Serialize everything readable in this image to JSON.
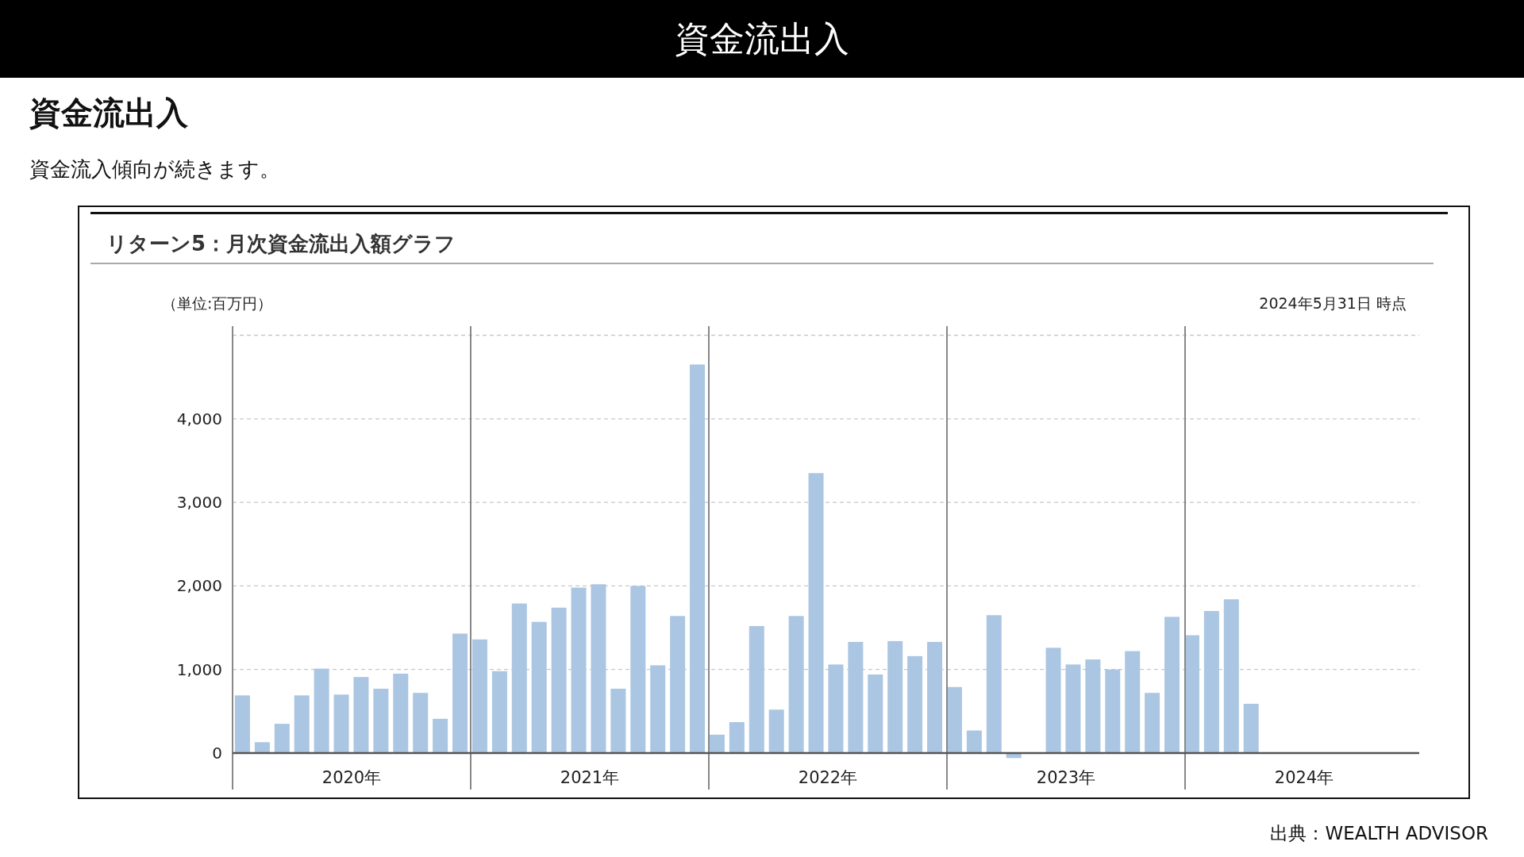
{
  "header": {
    "title": "資金流出入"
  },
  "section": {
    "heading": "資金流出入",
    "description": "資金流入傾向が続きます。"
  },
  "chart_panel": {
    "year_labels": [
      "2020年",
      "2021年",
      "2022年",
      "2023年",
      "2024年"
    ],
    "chart_data": {
      "type": "bar",
      "title": "リターン5：月次資金流出入額グラフ",
      "ylabel": "（単位:百万円）",
      "annotations": [
        {
          "text": "2024年5月31日 時点"
        }
      ],
      "grid": true,
      "categories": [
        null,
        null,
        null,
        null,
        null,
        null,
        null,
        null,
        null,
        null,
        null,
        null,
        null,
        null,
        null,
        null,
        null,
        null,
        null,
        null,
        null,
        null,
        null,
        null,
        null,
        null,
        null,
        null,
        null,
        null,
        null,
        null,
        null,
        null,
        null,
        null,
        null,
        null,
        null,
        null,
        null,
        null,
        null,
        null,
        null,
        null,
        null,
        null,
        null,
        null,
        null,
        null,
        null,
        null,
        null,
        null,
        null,
        null,
        null,
        null
      ],
      "series": [
        {
          "color": "#abc6e2",
          "values": [
            690,
            130,
            350,
            690,
            1010,
            700,
            910,
            770,
            950,
            720,
            410,
            1430,
            1360,
            980,
            1790,
            1570,
            1740,
            1980,
            2020,
            770,
            2000,
            1050,
            1640,
            4650,
            220,
            370,
            1520,
            520,
            1640,
            3350,
            1060,
            1330,
            940,
            1340,
            1160,
            1330,
            790,
            270,
            1650,
            -60,
            0,
            1260,
            1060,
            1120,
            1000,
            1220,
            720,
            1630,
            1410,
            1700,
            1840,
            590,
            null,
            null,
            null,
            null,
            null,
            null,
            null,
            null
          ]
        }
      ],
      "ylim": [
        -437,
        5000
      ],
      "yticks": [
        {
          "value": 0,
          "label": "0"
        },
        {
          "value": 1000,
          "label": "1,000"
        },
        {
          "value": 2000,
          "label": "2,000"
        },
        {
          "value": 3000,
          "label": "3,000"
        },
        {
          "value": 4000,
          "label": "4,000"
        }
      ]
    }
  },
  "source": "出典：WEALTH ADVISOR"
}
